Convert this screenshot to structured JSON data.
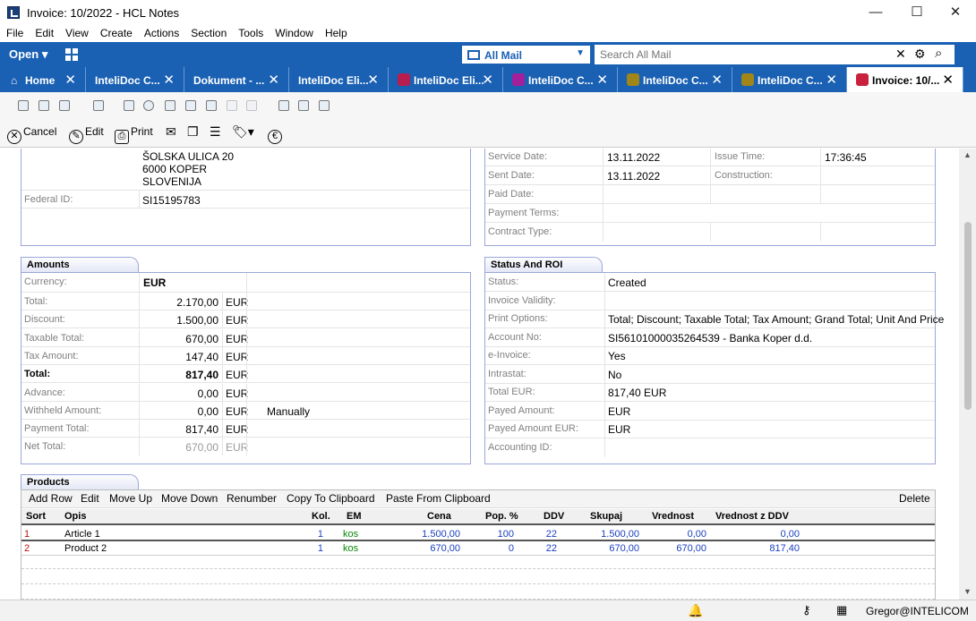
{
  "window": {
    "title": "Invoice: 10/2022 - HCL Notes",
    "minimize": "—",
    "maximize": "☐",
    "close": "✕"
  },
  "menu": [
    "File",
    "Edit",
    "View",
    "Create",
    "Actions",
    "Section",
    "Tools",
    "Window",
    "Help"
  ],
  "toolbar": {
    "open": "Open",
    "mailbox": "All Mail",
    "search_placeholder": "Search All Mail"
  },
  "tabs": [
    {
      "label": "Home",
      "color": "#ffffff"
    },
    {
      "label": "InteliDoc C...",
      "color": ""
    },
    {
      "label": "Dokument - ...",
      "color": ""
    },
    {
      "label": "InteliDoc Eli...",
      "color": ""
    },
    {
      "label": "InteliDoc Eli...",
      "color": "#b81d4f"
    },
    {
      "label": "InteliDoc C...",
      "color": "#a3209b"
    },
    {
      "label": "InteliDoc C...",
      "color": "#a08519"
    },
    {
      "label": "InteliDoc C...",
      "color": "#a08519"
    },
    {
      "label": "Invoice: 10/...",
      "color": "#c9213d"
    }
  ],
  "actions": {
    "cancel": "Cancel",
    "edit": "Edit",
    "print": "Print",
    "euro": "€"
  },
  "address": {
    "street": "ŠOLSKA ULICA 20",
    "city": "6000 KOPER",
    "country": "SLOVENIJA",
    "federal_label": "Federal ID:",
    "federal_value": "SI15195783"
  },
  "dates": {
    "service_label": "Service Date:",
    "service_value": "13.11.2022",
    "issue_time_label": "Issue Time:",
    "issue_time_value": "17:36:45",
    "sent_label": "Sent Date:",
    "sent_value": "13.11.2022",
    "construction_label": "Construction:",
    "paid_label": "Paid Date:",
    "payment_terms_label": "Payment Terms:",
    "contract_type_label": "Contract Type:"
  },
  "amounts": {
    "title": "Amounts",
    "currency_label": "Currency:",
    "currency_value": "EUR",
    "rows": [
      {
        "label": "Total:",
        "value": "2.170,00",
        "cur": "EUR",
        "bold": false
      },
      {
        "label": "Discount:",
        "value": "1.500,00",
        "cur": "EUR",
        "bold": false
      },
      {
        "label": "Taxable Total:",
        "value": "670,00",
        "cur": "EUR",
        "bold": false
      },
      {
        "label": "Tax Amount:",
        "value": "147,40",
        "cur": "EUR",
        "bold": false
      },
      {
        "label": "Total:",
        "value": "817,40",
        "cur": "EUR",
        "bold": true
      },
      {
        "label": "Advance:",
        "value": "0,00",
        "cur": "EUR",
        "bold": false
      },
      {
        "label": "Withheld Amount:",
        "value": "0,00",
        "cur": "EUR",
        "bold": false,
        "extra": "Manually"
      },
      {
        "label": "Payment Total:",
        "value": "817,40",
        "cur": "EUR",
        "bold": false
      },
      {
        "label": "Net Total:",
        "value": "670,00",
        "cur": "EUR",
        "bold": false,
        "muted": true
      }
    ]
  },
  "status": {
    "title": "Status And ROI",
    "rows": [
      {
        "label": "Status:",
        "value": "Created"
      },
      {
        "label": "Invoice Validity:",
        "value": ""
      },
      {
        "label": "Print Options:",
        "value": "Total; Discount; Taxable Total; Tax Amount; Grand Total; Unit And Price"
      },
      {
        "label": "Account No:",
        "value": "SI56101000035264539 - Banka Koper d.d."
      },
      {
        "label": "e-Invoice:",
        "value": "Yes"
      },
      {
        "label": "Intrastat:",
        "value": "No"
      },
      {
        "label": "Total EUR:",
        "value": "817,40 EUR"
      },
      {
        "label": "Payed Amount:",
        "value": " EUR"
      },
      {
        "label": "Payed Amount EUR:",
        "value": " EUR"
      },
      {
        "label": "Accounting ID:",
        "value": ""
      }
    ]
  },
  "products": {
    "title": "Products",
    "tools": [
      "Add Row",
      "Edit",
      "Move Up",
      "Move Down",
      "Renumber",
      "Copy To Clipboard",
      "Paste From Clipboard"
    ],
    "delete": "Delete",
    "columns": [
      "Sort",
      "Opis",
      "Kol.",
      "EM",
      "Cena",
      "Pop. %",
      "DDV",
      "Skupaj",
      "Vrednost",
      "Vrednost z DDV"
    ],
    "rows": [
      [
        "1",
        "Article 1",
        "1",
        "kos",
        "1.500,00",
        "100",
        "22",
        "1.500,00",
        "0,00",
        "0,00"
      ],
      [
        "2",
        "Product 2",
        "1",
        "kos",
        "670,00",
        "0",
        "22",
        "670,00",
        "670,00",
        "817,40"
      ]
    ]
  },
  "statusbar": {
    "user": "Gregor@INTELICOM ▴"
  },
  "colors": {
    "brand_blue": "#1a60b3",
    "section_border": "#9aa7d8"
  }
}
